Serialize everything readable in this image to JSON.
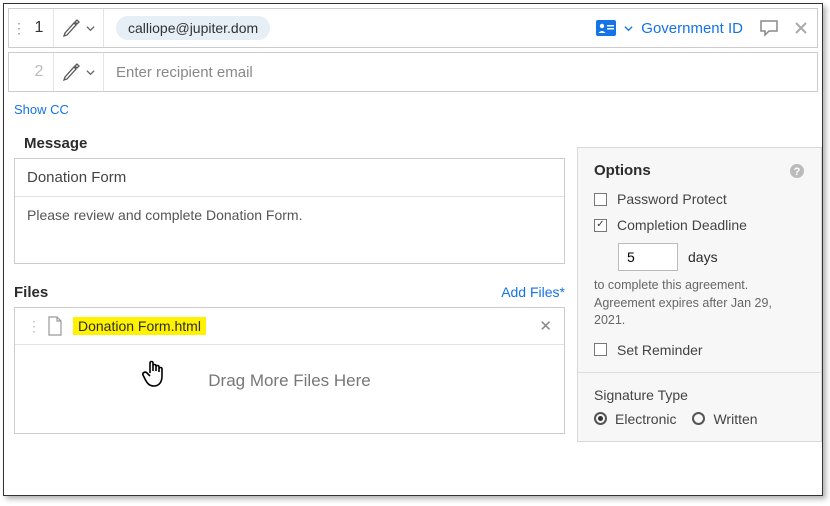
{
  "recipients": {
    "r1": {
      "num": "1",
      "email": "calliope@jupiter.dom",
      "auth_label": "Government ID"
    },
    "r2": {
      "num": "2",
      "placeholder": "Enter recipient email"
    }
  },
  "show_cc": "Show CC",
  "message": {
    "label": "Message",
    "subject": "Donation Form",
    "body": "Please review and complete Donation Form."
  },
  "files": {
    "label": "Files",
    "add_label": "Add Files*",
    "items": [
      {
        "name": "Donation Form.html"
      }
    ],
    "drop_hint": "Drag More Files Here"
  },
  "options": {
    "title": "Options",
    "password_protect": "Password Protect",
    "completion_deadline": "Completion Deadline",
    "days_value": "5",
    "days_unit": "days",
    "hint_line1": "to complete this agreement.",
    "hint_line2": "Agreement expires after Jan 29, 2021.",
    "set_reminder": "Set Reminder",
    "sig_type_label": "Signature Type",
    "sig_electronic": "Electronic",
    "sig_written": "Written"
  }
}
